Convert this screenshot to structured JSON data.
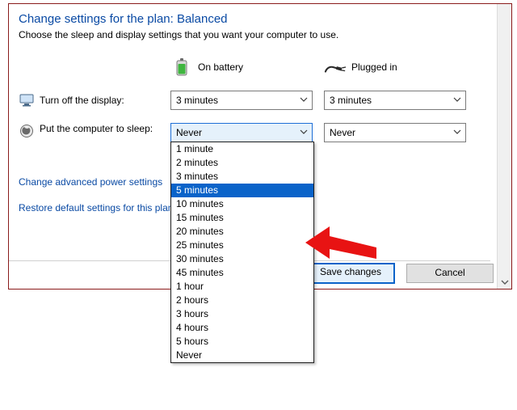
{
  "title": "Change settings for the plan: Balanced",
  "description": "Choose the sleep and display settings that you want your computer to use.",
  "columns": {
    "battery": "On battery",
    "plugged": "Plugged in"
  },
  "rows": {
    "display": {
      "label": "Turn off the display:",
      "battery_value": "3 minutes",
      "plugged_value": "3 minutes"
    },
    "sleep": {
      "label": "Put the computer to sleep:",
      "battery_value": "Never",
      "plugged_value": "Never"
    }
  },
  "dropdown_options": [
    "1 minute",
    "2 minutes",
    "3 minutes",
    "5 minutes",
    "10 minutes",
    "15 minutes",
    "20 minutes",
    "25 minutes",
    "30 minutes",
    "45 minutes",
    "1 hour",
    "2 hours",
    "3 hours",
    "4 hours",
    "5 hours",
    "Never"
  ],
  "dropdown_highlight_index": 3,
  "links": {
    "advanced": "Change advanced power settings",
    "restore": "Restore default settings for this plan"
  },
  "buttons": {
    "save": "Save changes",
    "cancel": "Cancel"
  }
}
